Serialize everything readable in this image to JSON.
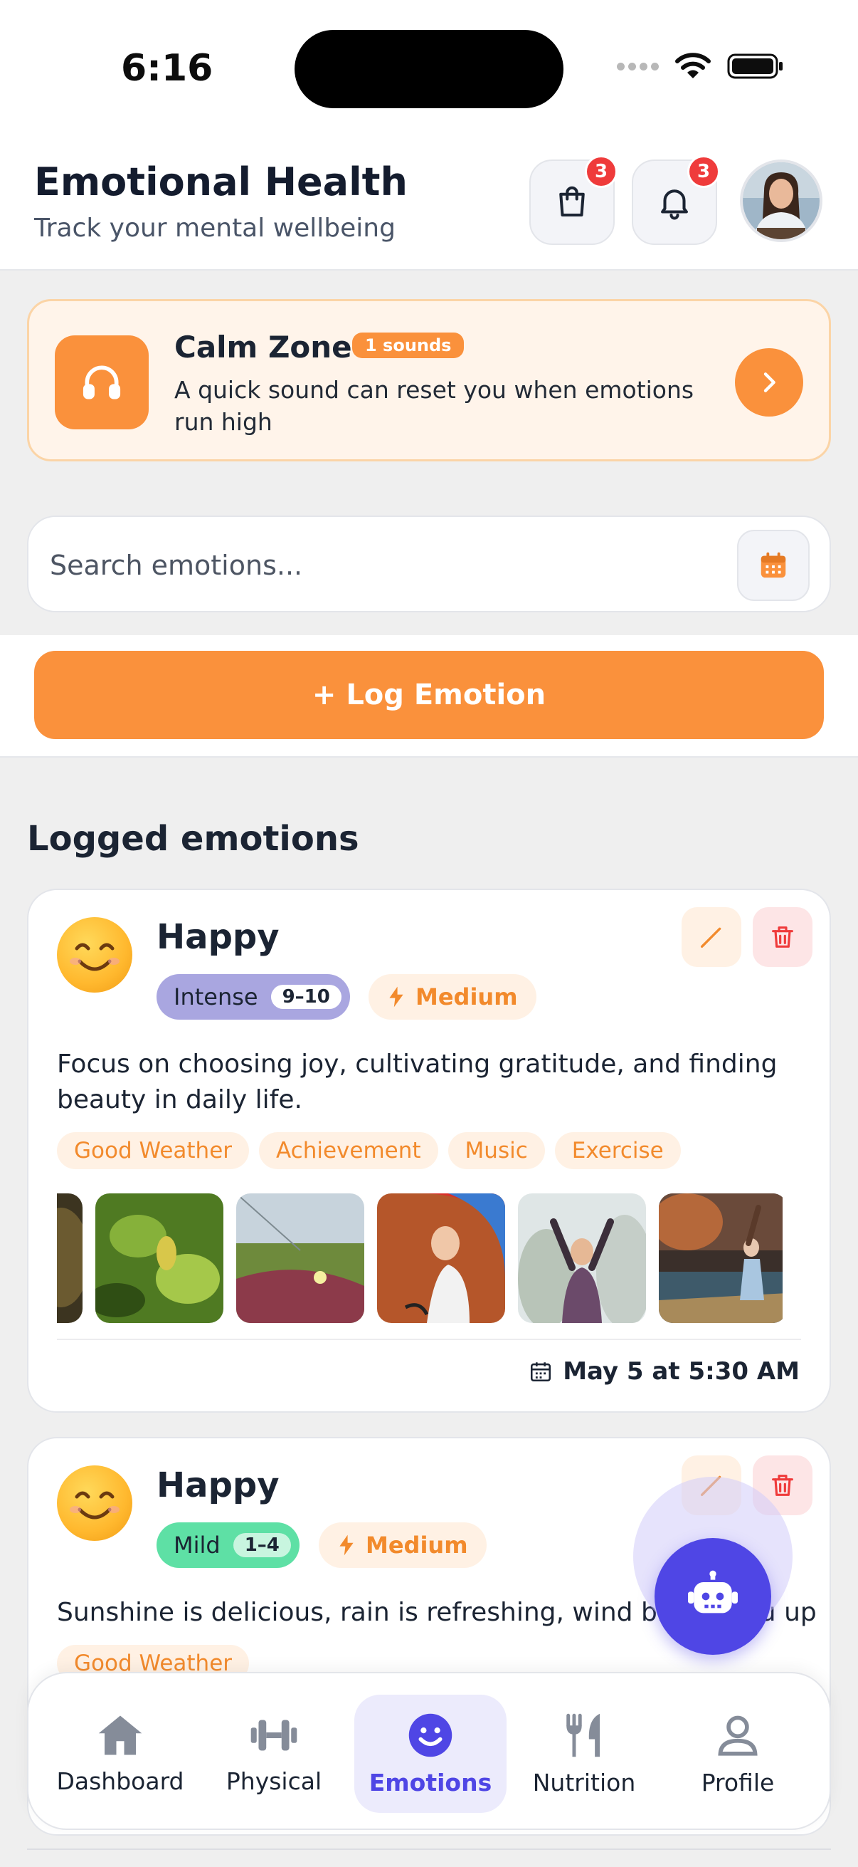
{
  "status_bar": {
    "time": "6:16"
  },
  "header": {
    "title": "Emotional Health",
    "subtitle": "Track your mental wellbeing",
    "cart_badge": "3",
    "notification_badge": "3"
  },
  "calm_zone": {
    "title": "Calm Zone",
    "pill": "1 sounds",
    "description": "A quick sound can reset you when emotions run high"
  },
  "search": {
    "placeholder": "Search emotions..."
  },
  "log_button": "+ Log Emotion",
  "section_title": "Logged emotions",
  "cards": [
    {
      "emotion": "Happy",
      "intensity_label": "Intense",
      "intensity_range": "9–10",
      "intensity_color": "#a9a6e0",
      "energy": "Medium",
      "description": "Focus on choosing joy, cultivating gratitude, and finding beauty in daily life.",
      "tags": [
        "Good Weather",
        "Achievement",
        "Music",
        "Exercise"
      ],
      "date": "May 5 at 5:30 AM"
    },
    {
      "emotion": "Happy",
      "intensity_label": "Mild",
      "intensity_range": "1–4",
      "intensity_color": "#5ee0a5",
      "energy": "Medium",
      "description": "Sunshine is delicious, rain is refreshing, wind brings you up",
      "tags": [
        "Good Weather"
      ]
    }
  ],
  "nav": [
    {
      "label": "Dashboard",
      "icon": "home-icon"
    },
    {
      "label": "Physical",
      "icon": "dumbbell-icon"
    },
    {
      "label": "Emotions",
      "icon": "smile-icon",
      "active": true
    },
    {
      "label": "Nutrition",
      "icon": "fork-knife-icon"
    },
    {
      "label": "Profile",
      "icon": "user-icon"
    }
  ],
  "colors": {
    "accent": "#fa913c",
    "primary": "#4f46e5",
    "danger": "#ef3b3b"
  }
}
